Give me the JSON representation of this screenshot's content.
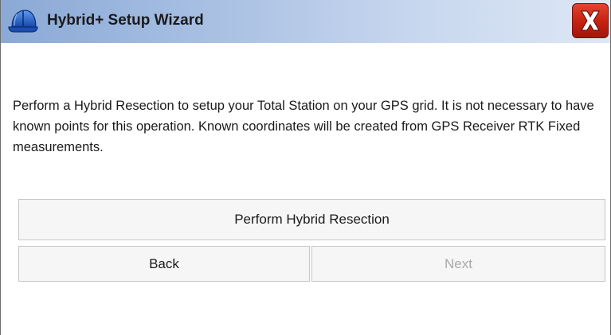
{
  "window": {
    "title": "Hybrid+ Setup Wizard",
    "close_glyph": "X"
  },
  "icons": {
    "title_icon": "hard-hat-icon",
    "close_icon": "close-icon"
  },
  "main": {
    "description": "Perform a Hybrid Resection to setup your Total Station on your GPS grid.  It is not necessary to have known points for this operation. Known coordinates will be created from GPS Receiver RTK Fixed measurements."
  },
  "buttons": {
    "perform_resection": "Perform Hybrid Resection",
    "back": "Back",
    "next": "Next"
  },
  "colors": {
    "titlebar_start": "#8aa9d6",
    "titlebar_end": "#dde7f6",
    "close_red": "#c4200f",
    "hat_blue": "#1f5fc8",
    "disabled_text": "#a8a8a8"
  }
}
